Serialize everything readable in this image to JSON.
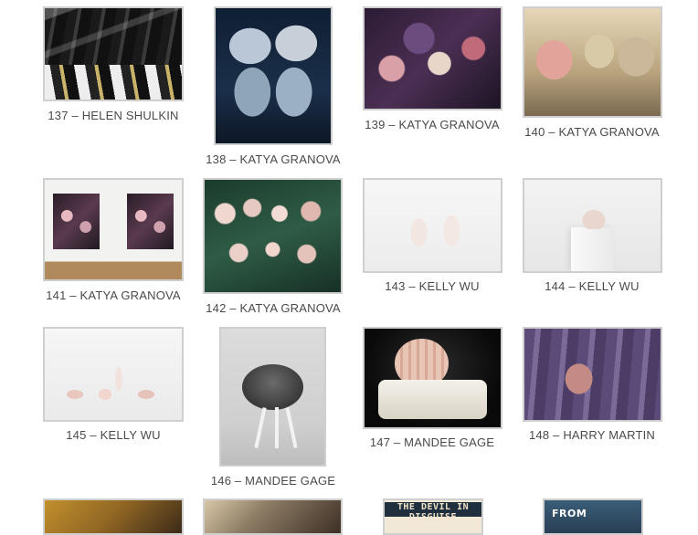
{
  "gallery": {
    "items": [
      {
        "caption": "137 – HELEN SHULKIN"
      },
      {
        "caption": "138 – KATYA GRANOVA"
      },
      {
        "caption": "139 – KATYA GRANOVA"
      },
      {
        "caption": "140 – KATYA GRANOVA"
      },
      {
        "caption": "141 – KATYA GRANOVA"
      },
      {
        "caption": "142 – KATYA GRANOVA"
      },
      {
        "caption": "143 – KELLY WU"
      },
      {
        "caption": "144 – KELLY WU"
      },
      {
        "caption": "145 – KELLY WU"
      },
      {
        "caption": "146 – MANDEE GAGE"
      },
      {
        "caption": "147 – MANDEE GAGE"
      },
      {
        "caption": "148 – HARRY MARTIN"
      }
    ],
    "partial_thumbnail_text": {
      "devil_title": "THE DEVIL IN DISGUISE",
      "from_title": "FROM"
    }
  }
}
